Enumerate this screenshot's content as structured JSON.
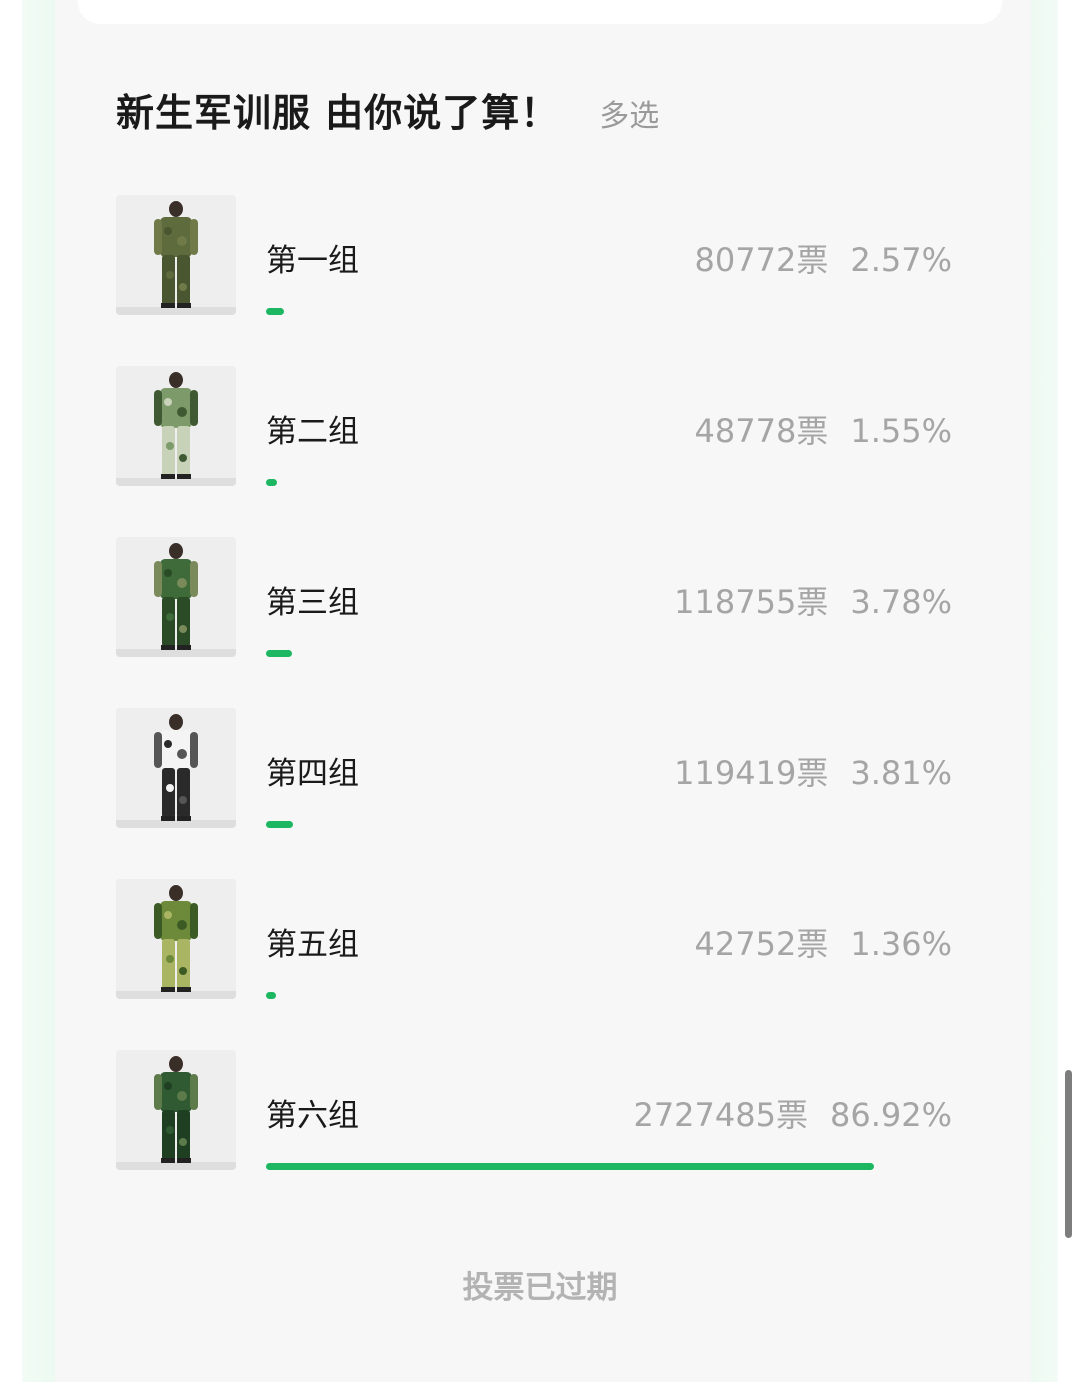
{
  "poll": {
    "title": "新生军训服 由你说了算！",
    "mode": "多选",
    "status": "投票已过期",
    "accent_color": "#1db761",
    "options": [
      {
        "label": "第一组",
        "votes": "80772票",
        "percent": "2.57%",
        "share": 0.0257,
        "image_icon": "camo-olive-uniform-photo",
        "palette": [
          "#5e6b3c",
          "#4a5630",
          "#6f7a48"
        ]
      },
      {
        "label": "第二组",
        "votes": "48778票",
        "percent": "1.55%",
        "share": 0.0155,
        "image_icon": "camo-woodland-light-photo",
        "palette": [
          "#7c9a6a",
          "#c7d2b8",
          "#3f5a32"
        ]
      },
      {
        "label": "第三组",
        "votes": "118755票",
        "percent": "3.78%",
        "share": 0.0378,
        "image_icon": "camo-dark-green-photo",
        "palette": [
          "#3f6a3a",
          "#2b4a26",
          "#7a8a5a"
        ]
      },
      {
        "label": "第四组",
        "votes": "119419票",
        "percent": "3.81%",
        "share": 0.0381,
        "image_icon": "white-black-tracksuit-photo",
        "palette": [
          "#f4f4f4",
          "#2a2a2a",
          "#555555"
        ]
      },
      {
        "label": "第五组",
        "votes": "42752票",
        "percent": "1.36%",
        "share": 0.0136,
        "image_icon": "camo-bright-green-photo",
        "palette": [
          "#6d8a3a",
          "#a9b562",
          "#3c5a24"
        ]
      },
      {
        "label": "第六组",
        "votes": "2727485票",
        "percent": "86.92%",
        "share": 0.8692,
        "image_icon": "camo-forest-green-photo",
        "palette": [
          "#2f5a32",
          "#1f3f22",
          "#5d7a4a"
        ]
      }
    ]
  }
}
